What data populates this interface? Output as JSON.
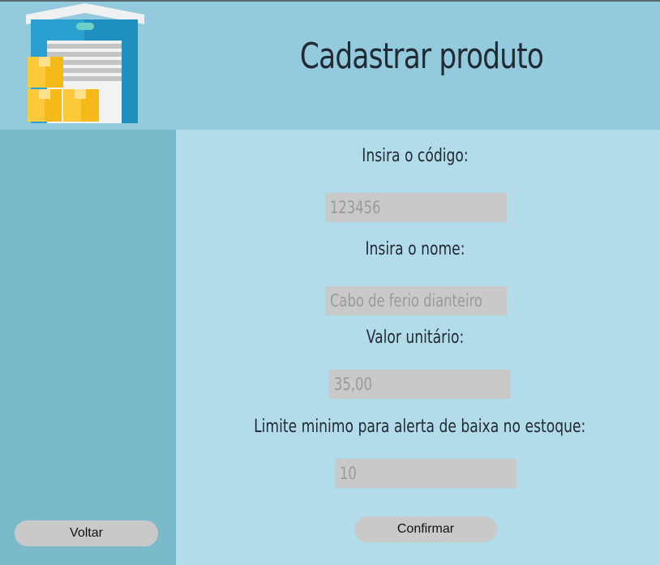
{
  "header": {
    "title": "Cadastrar produto"
  },
  "form": {
    "code_label": "Insira o código:",
    "code_value": "123456",
    "name_label": "Insira o nome:",
    "name_value": "Cabo de ferio dianteiro",
    "price_label": "Valor unitário:",
    "price_value": "35,00",
    "limit_label": "Limite minimo para alerta de baixa no estoque:",
    "limit_value": "10"
  },
  "buttons": {
    "back": "Voltar",
    "confirm": "Confirmar"
  },
  "colors": {
    "header_bg": "#94cadd",
    "sidebar_bg": "#7bbacb",
    "main_bg": "#b2dcea",
    "field_bg": "#c9c9c9"
  },
  "icons": {
    "logo": "warehouse-icon"
  }
}
